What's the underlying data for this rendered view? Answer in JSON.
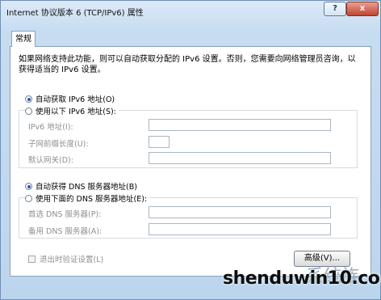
{
  "window": {
    "title": "Internet 协议版本 6 (TCP/IPv6) 属性",
    "help_label": "?",
    "close_label": "x"
  },
  "tabs": [
    {
      "label": "常规"
    }
  ],
  "description": "如果网络支持此功能，则可以自动获取分配的 IPv6 设置。否则，您需要向网络管理员咨询，以获得适当的 IPv6 设置。",
  "ip": {
    "auto_label": "自动获取 IPv6 地址(O)",
    "manual_label": "使用以下 IPv6 地址(S):",
    "selected": "auto",
    "fields": [
      {
        "label": "IPv6 地址(I):",
        "value": ""
      },
      {
        "label": "子网前缀长度(U):",
        "value": ""
      },
      {
        "label": "默认网关(D):",
        "value": ""
      }
    ]
  },
  "dns": {
    "auto_label": "自动获得 DNS 服务器地址(B)",
    "manual_label": "使用下面的 DNS 服务器地址(E):",
    "selected": "auto",
    "fields": [
      {
        "label": "首选 DNS 服务器(P):",
        "value": ""
      },
      {
        "label": "备用 DNS 服务器(A):",
        "value": ""
      }
    ]
  },
  "validate_label": "退出时验证设置(L)",
  "advanced_label": "高级(V)...",
  "watermark": "shenduwin10.com",
  "watermark_partial": "系统族"
}
